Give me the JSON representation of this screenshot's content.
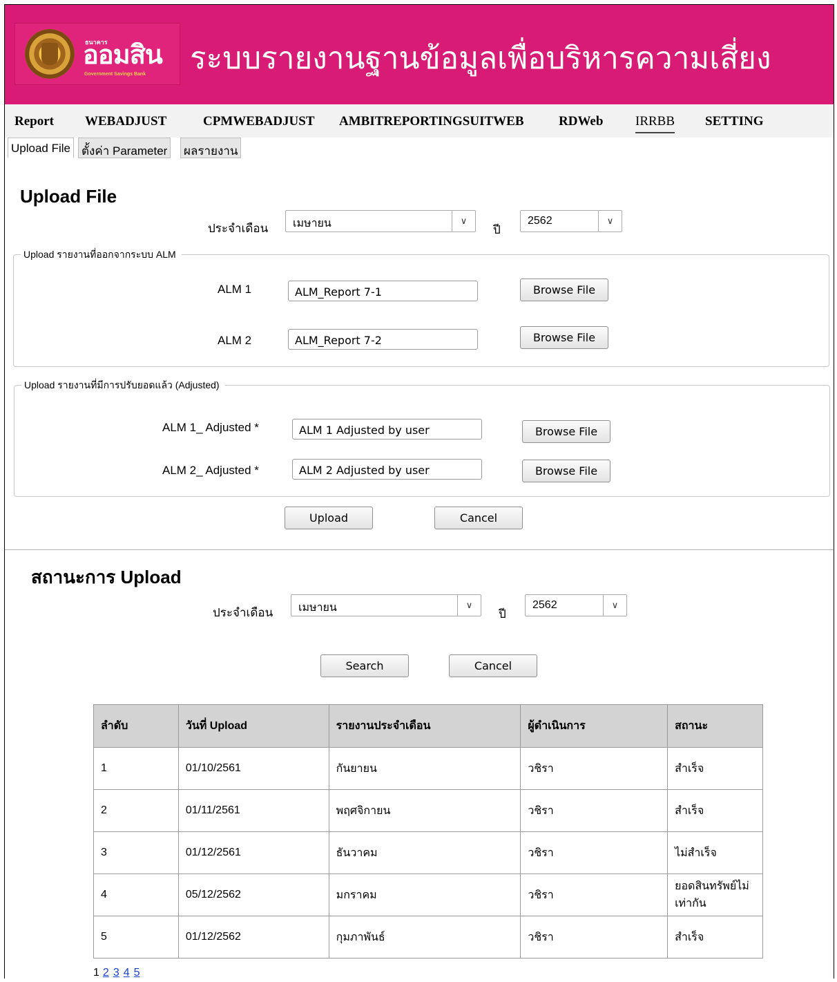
{
  "header": {
    "logo_small": "ธนาคาร",
    "logo_name": "ออมสิน",
    "logo_en": "Government Savings Bank",
    "title": "ระบบรายงานฐานข้อมูลเพื่อบริหารความเสี่ยง"
  },
  "nav": {
    "items": [
      "Report",
      "WEBADJUST",
      "CPMWEBADJUST",
      "AMBITREPORTINGSUITWEB",
      "RDWeb",
      "IRRBB",
      "SETTING"
    ],
    "active": "IRRBB"
  },
  "subtabs": [
    "Upload File",
    "ตั้งค่า Parameter",
    "ผลรายงาน"
  ],
  "upload": {
    "title": "Upload File",
    "month_label": "ประจำเดือน",
    "month_value": "เมษายน",
    "year_label": "ปี",
    "year_value": "2562",
    "alm_legend": "Upload รายงานที่ออกจากระบบ ALM",
    "alm1_label": "ALM 1",
    "alm1_value": "ALM_Report 7-1",
    "alm2_label": "ALM 2",
    "alm2_value": "ALM_Report 7-2",
    "browse_label": "Browse File",
    "adj_legend": "Upload รายงานที่มีการปรับยอดแล้ว (Adjusted)",
    "adj1_label": "ALM 1_ Adjusted *",
    "adj1_value": "ALM 1 Adjusted by user",
    "adj2_label": "ALM 2_ Adjusted *",
    "adj2_value": "ALM 2 Adjusted by user",
    "upload_button": "Upload",
    "cancel_button": "Cancel"
  },
  "status": {
    "title": "สถานะการ Upload",
    "month_label": "ประจำเดือน",
    "month_value": "เมษายน",
    "year_label": "ปี",
    "year_value": "2562",
    "search_button": "Search",
    "cancel_button": "Cancel",
    "columns": [
      "ลำดับ",
      "วันที่ Upload",
      "รายงานประจำเดือน",
      "ผู้ดำเนินการ",
      "สถานะ"
    ],
    "rows": [
      [
        "1",
        "01/10/2561",
        "กันยายน",
        "วชิรา",
        "สำเร็จ"
      ],
      [
        "2",
        "01/11/2561",
        "พฤศจิกายน",
        "วชิรา",
        "สำเร็จ"
      ],
      [
        "3",
        "01/12/2561",
        "ธันวาคม",
        "วชิรา",
        "ไม่สำเร็จ"
      ],
      [
        "4",
        "05/12/2562",
        "มกราคม",
        "วชิรา",
        "ยอดสินทรัพย์ไม่เท่ากัน"
      ],
      [
        "5",
        "01/12/2562",
        "กุมภาพันธ์",
        "วชิรา",
        "สำเร็จ"
      ]
    ],
    "pager": {
      "current": "1",
      "pages": [
        "2",
        "3",
        "4",
        "5"
      ]
    }
  },
  "colors": {
    "header_bg": "#d81b74",
    "nav_bg": "#f2f2f2",
    "table_header_bg": "#d3d3d3",
    "link": "#1a3fcf"
  }
}
